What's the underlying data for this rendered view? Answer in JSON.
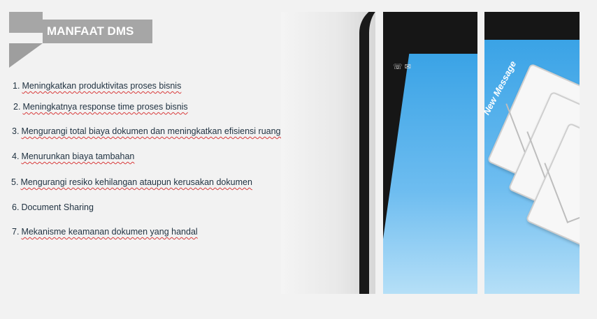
{
  "title": "MANFAAT DMS",
  "items": [
    {
      "num": "1.",
      "text": "Meningkatkan produktivitas proses bisnis"
    },
    {
      "num": "2.",
      "text": "Meningkatnya response time proses bisnis"
    },
    {
      "num": "3.",
      "text": "Mengurangi total biaya dokumen dan meningkatkan efisiensi ruang penyimpanan"
    },
    {
      "num": "4.",
      "text": "Menurunkan biaya tambahan"
    },
    {
      "num": "5.",
      "text": "Mengurangi resiko kehilangan ataupun kerusakan dokumen"
    },
    {
      "num": "6.",
      "text": "Document Sharing"
    },
    {
      "num": "7.",
      "text": "Mekanisme keamanan dokumen yang handal"
    }
  ],
  "image_text": "New Message",
  "colors": {
    "title_bg": "#a6a6a6",
    "text": "#1f3140",
    "screen": "#3aa3e6"
  }
}
